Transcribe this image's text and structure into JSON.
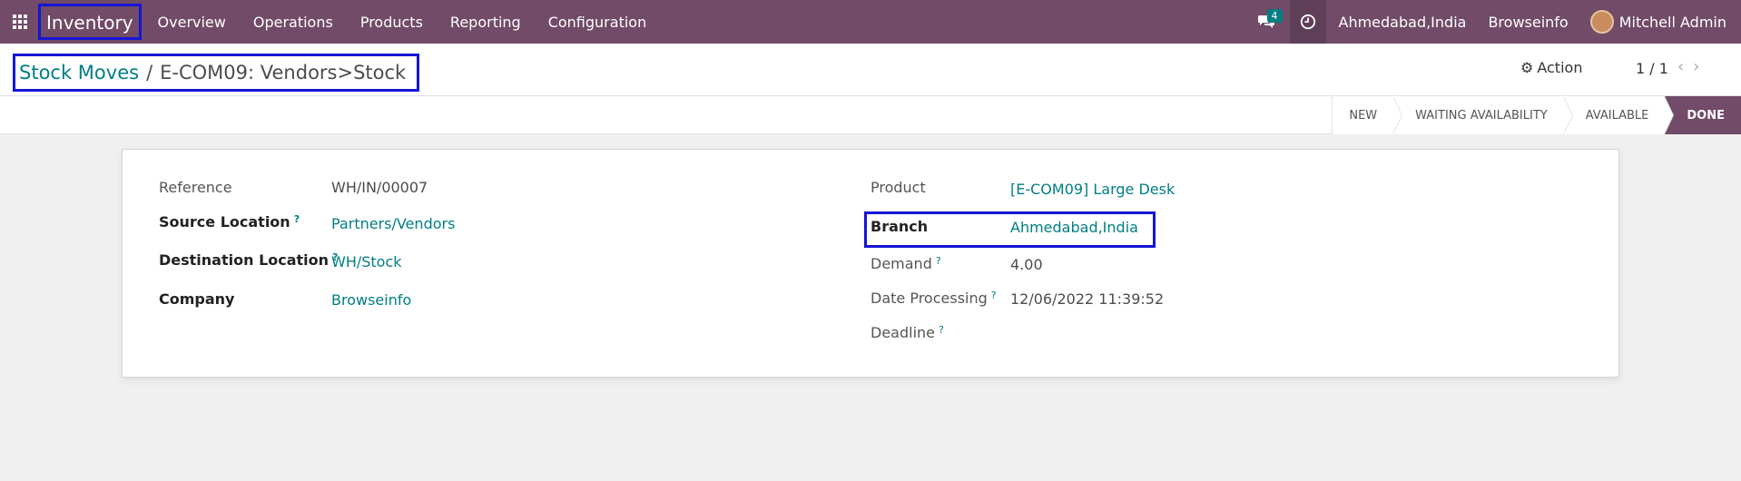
{
  "navbar": {
    "app_name": "Inventory",
    "menu": [
      "Overview",
      "Operations",
      "Products",
      "Reporting",
      "Configuration"
    ],
    "chat_count": "4",
    "company_location": "Ahmedabad,India",
    "company_name": "Browseinfo",
    "user": "Mitchell Admin"
  },
  "breadcrumb": {
    "parent": "Stock Moves",
    "separator": "/",
    "current": "E-COM09: Vendors>Stock"
  },
  "control": {
    "action_label": "Action",
    "pager": "1 / 1"
  },
  "status_stages": [
    "NEW",
    "WAITING AVAILABILITY",
    "AVAILABLE",
    "DONE"
  ],
  "form": {
    "left": [
      {
        "label": "Reference",
        "value": "WH/IN/00007"
      },
      {
        "label": "Source Location",
        "value": "Partners/Vendors"
      },
      {
        "label": "Destination Location",
        "value": "WH/Stock"
      },
      {
        "label": "Company",
        "value": "Browseinfo"
      }
    ],
    "right": [
      {
        "label": "Product",
        "value": "[E-COM09] Large Desk"
      },
      {
        "label": "Branch",
        "value": "Ahmedabad,India"
      },
      {
        "label": "Demand",
        "value": "4.00"
      },
      {
        "label": "Date Processing",
        "value": "12/06/2022 11:39:52"
      },
      {
        "label": "Deadline",
        "value": ""
      }
    ],
    "help_marker": "?"
  },
  "colors": {
    "navbar": "#714B67",
    "link": "#017e84",
    "highlight": "#1515d6"
  }
}
